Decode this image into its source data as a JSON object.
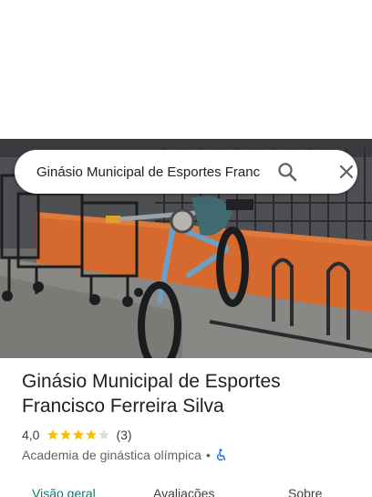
{
  "search": {
    "query": "Ginásio Municipal de Esportes Franc"
  },
  "place": {
    "name_line1": "Ginásio Municipal de Esportes",
    "name_line2": "Francisco Ferreira Silva",
    "rating": "4,0",
    "stars_filled": 4,
    "stars_total": 5,
    "review_count": "(3)",
    "category": "Academia de ginástica olímpica",
    "separator": "•"
  },
  "tabs": [
    {
      "label": "Visão geral",
      "active": true
    },
    {
      "label": "Avaliações",
      "active": false
    },
    {
      "label": "Sobre",
      "active": false
    }
  ],
  "colors": {
    "star": "#fbbc04",
    "star_empty": "#dadce0",
    "active_tab": "#0b7a6e",
    "accessibility": "#1a73e8"
  },
  "icons": {
    "search": "search-icon",
    "close": "close-icon",
    "accessibility": "wheelchair-icon"
  }
}
